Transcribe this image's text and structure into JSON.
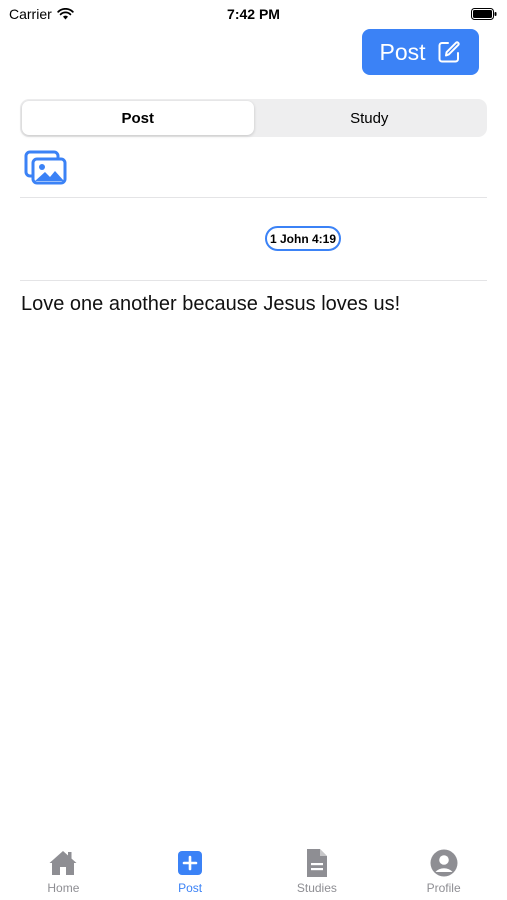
{
  "status_bar": {
    "carrier": "Carrier",
    "time": "7:42 PM"
  },
  "header": {
    "post_button_label": "Post",
    "post_button_icon": "compose-icon"
  },
  "segmented_control": {
    "segments": [
      {
        "label": "Post",
        "selected": true
      },
      {
        "label": "Study",
        "selected": false
      }
    ]
  },
  "composer": {
    "photo_icon": "photo-library-icon",
    "verse_reference": "1 John 4:19",
    "body_text": "Love one another because Jesus loves us!"
  },
  "tab_bar": {
    "items": [
      {
        "label": "Home",
        "icon": "house-icon",
        "active": false
      },
      {
        "label": "Post",
        "icon": "plus-square-icon",
        "active": true
      },
      {
        "label": "Studies",
        "icon": "document-icon",
        "active": false
      },
      {
        "label": "Profile",
        "icon": "person-circle-icon",
        "active": false
      }
    ]
  },
  "colors": {
    "accent": "#3B82F6",
    "inactive": "#8E8E93",
    "segment_bg": "#EEEEEF"
  }
}
